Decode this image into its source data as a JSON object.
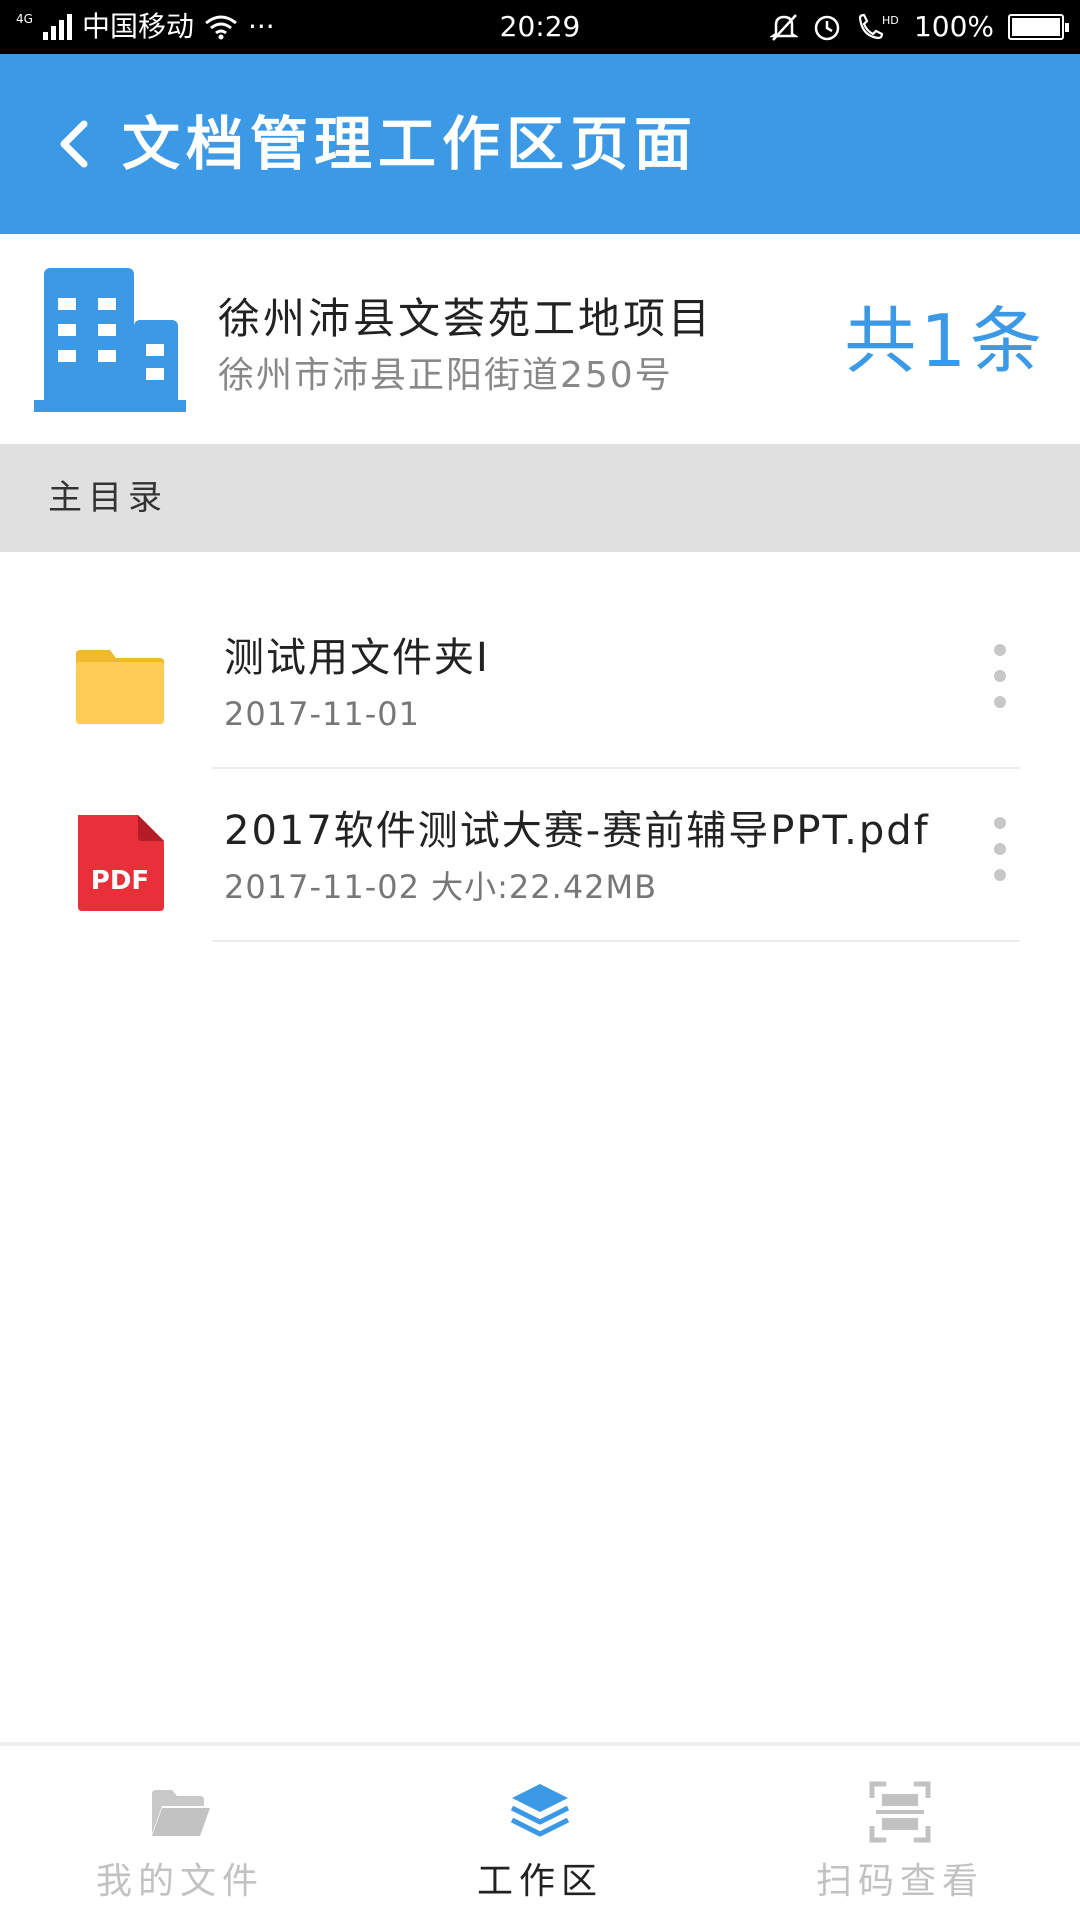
{
  "status_bar": {
    "network": "4G",
    "carrier": "中国移动",
    "more": "···",
    "time": "20:29",
    "hd": "HD",
    "battery": "100%",
    "battery_level": 1.0
  },
  "app_bar": {
    "title": "文档管理工作区页面"
  },
  "project": {
    "name": "徐州沛县文荟苑工地项目",
    "address": "徐州市沛县正阳街道250号",
    "count_label": "共1条"
  },
  "section": {
    "label": "主目录"
  },
  "files": [
    {
      "type": "folder",
      "name": "测试用文件夹I",
      "meta": "2017-11-01"
    },
    {
      "type": "pdf",
      "name": "2017软件测试大赛-赛前辅导PPT.pdf",
      "meta": "2017-11-02 大小:22.42MB",
      "badge": "PDF"
    }
  ],
  "bottom_nav": [
    {
      "label": "我的文件",
      "icon": "folder-icon",
      "active": false
    },
    {
      "label": "工作区",
      "icon": "layers-icon",
      "active": true
    },
    {
      "label": "扫码查看",
      "icon": "scan-icon",
      "active": false
    }
  ],
  "colors": {
    "primary": "#3b99e6",
    "folder": "#ffcc55",
    "pdf": "#e8303a",
    "inactive": "#c2c2c2"
  }
}
